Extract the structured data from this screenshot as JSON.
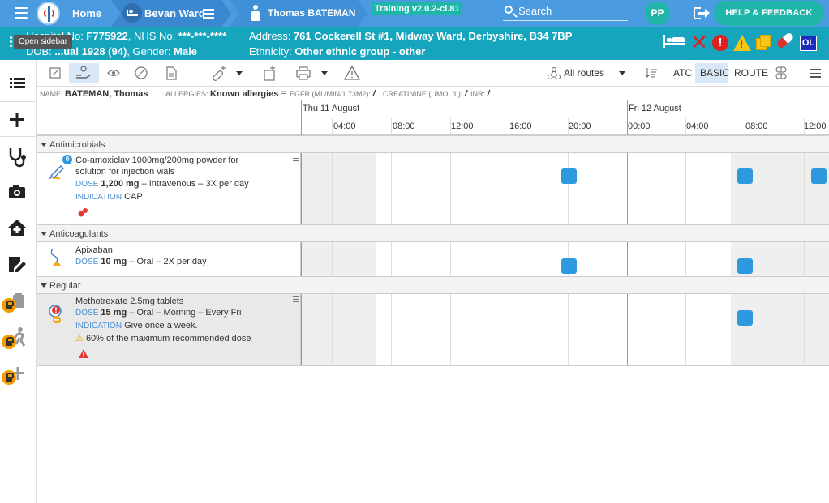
{
  "topnav": {
    "home": "Home",
    "ward": "Bevan Ward",
    "patient": "Thomas BATEMAN",
    "training": "Training v2.0.2-ci.81",
    "search_placeholder": "Search",
    "user_initials": "PP",
    "help": "HELP & FEEDBACK"
  },
  "banner": {
    "hospital_label": "Hospital No: ",
    "hospital_no": "F775922",
    "nhs_label": ", NHS No: ",
    "nhs_no": "***-***-****",
    "dob_label": "DOB: ",
    "dob": "...ual 1928 (94)",
    "gender_label": ", Gender: ",
    "gender": "Male",
    "address_label": "Address: ",
    "address": "761 Cockerell St #1, Midway Ward, Derbyshire, B34 7BP",
    "ethnicity_label": "Ethnicity: ",
    "ethnicity": "Other ethnic group - other",
    "ol_badge": "OL",
    "tooltip": "Open sidebar"
  },
  "toolbar": {
    "routes": "All routes",
    "atc": "ATC",
    "basic": "BASIC",
    "route": "ROUTE"
  },
  "info": {
    "name_label": "NAME:",
    "name": "BATEMAN, Thomas",
    "allergies_label": "ALLERGIES:",
    "allergies": "Known allergies",
    "egfr_label": "EGFR (ML/MIN/1.73M2):",
    "egfr": "/",
    "creat_label": "CREATININE (UMOL/L):",
    "creat": "/",
    "inr_label": "INR:",
    "inr": "/"
  },
  "timeline": {
    "day1": "Thu 11 August",
    "day2": "Fri 12 August",
    "hours": [
      "04:00",
      "08:00",
      "12:00",
      "16:00",
      "20:00",
      "00:00",
      "04:00",
      "08:00",
      "12:00"
    ]
  },
  "groups": [
    {
      "label": "Antimicrobials",
      "meds": [
        {
          "name": "Co-amoxiclav 1000mg/200mg powder for solution for injection vials",
          "badge": "0",
          "dose_label": "DOSE",
          "dose": "1,200 mg",
          "route_freq": "– Intravenous – 3X per day",
          "indication_label": "INDICATION",
          "indication": "CAP"
        }
      ]
    },
    {
      "label": "Anticoagulants",
      "meds": [
        {
          "name": "Apixaban",
          "dose_label": "DOSE",
          "dose": "10 mg",
          "route_freq": "– Oral – 2X per day"
        }
      ]
    },
    {
      "label": "Regular",
      "meds": [
        {
          "name": "Methotrexate 2.5mg tablets",
          "dose_label": "DOSE",
          "dose": "15 mg",
          "route_freq": "– Oral – Morning – Every Fri",
          "indication_label": "INDICATION",
          "indication": "Give once a week.",
          "warning": "60% of the maximum recommended dose"
        }
      ]
    }
  ],
  "colors": {
    "nav": "#4a9be0",
    "banner": "#17a5bd",
    "accent": "#1fb5a8",
    "dose_block": "#2d9ae0",
    "now_line": "#e53935"
  }
}
